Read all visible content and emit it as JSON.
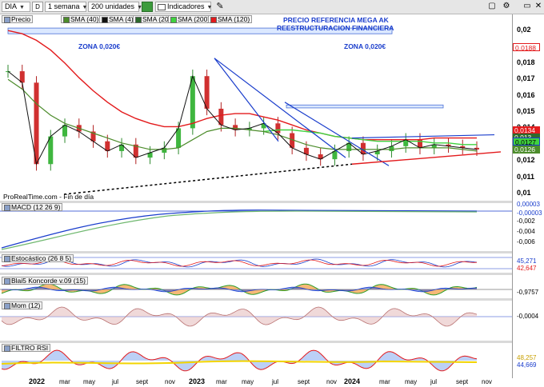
{
  "toolbar": {
    "symbol": "DIA",
    "period": "1 semana",
    "units": "200 unidades",
    "indicators": "Indicadores"
  },
  "legend": [
    {
      "label": "Precio",
      "color": "#8aa0c8"
    },
    {
      "label": "SMA (40)",
      "color": "#4c8c2b"
    },
    {
      "label": "SMA (4)",
      "color": "#111111"
    },
    {
      "label": "SMA (20)",
      "color": "#2d6a2d"
    },
    {
      "label": "SMA (200)",
      "color": "#3fd23f"
    },
    {
      "label": "SMA (120)",
      "color": "#e31a1c"
    }
  ],
  "annotations": {
    "headline_1": "PRECIO REFERENCIA MEGA AK",
    "headline_2": "REESTRUCTURACION FINANCIERA",
    "zone_left": "ZONA 0,020€",
    "zone_right": "ZONA 0,020€",
    "attribution": "ProRealTime.com - Fin de día"
  },
  "price_axis": [
    "0,02",
    "0,019",
    "0,018",
    "0,017",
    "0,016",
    "0,015",
    "0,014",
    "0,013",
    "0,012",
    "0,011",
    "0,01"
  ],
  "price_tags": {
    "sma120": "0,0188",
    "sma200": "0,0134",
    "sma20": "0,013",
    "price": "0,0127",
    "sma40": "0,0126"
  },
  "x_axis": [
    {
      "label": "2022",
      "year": true
    },
    {
      "label": "mar",
      "year": false
    },
    {
      "label": "may",
      "year": false
    },
    {
      "label": "jul",
      "year": false
    },
    {
      "label": "sept",
      "year": false
    },
    {
      "label": "nov",
      "year": false
    },
    {
      "label": "2023",
      "year": true
    },
    {
      "label": "mar",
      "year": false
    },
    {
      "label": "may",
      "year": false
    },
    {
      "label": "jul",
      "year": false
    },
    {
      "label": "sept",
      "year": false
    },
    {
      "label": "nov",
      "year": false
    },
    {
      "label": "2024",
      "year": true
    },
    {
      "label": "mar",
      "year": false
    },
    {
      "label": "may",
      "year": false
    },
    {
      "label": "jul",
      "year": false
    },
    {
      "label": "sept",
      "year": false
    },
    {
      "label": "nov",
      "year": false
    }
  ],
  "panels": {
    "macd": {
      "label": "MACD (12 26 9)",
      "axis": [
        "0,00003",
        "-0,002",
        "-0,004",
        "-0,006"
      ],
      "tags": [
        "0,00003",
        "-0,00003"
      ]
    },
    "stoch": {
      "label": "Estocástico (26 8 5)",
      "tags": [
        "45,271",
        "42,647"
      ]
    },
    "blai": {
      "label": "Blai5 Koncorde v.09 (15)",
      "tags": [
        "-0,9757"
      ]
    },
    "mom": {
      "label": "Mom (12)",
      "tags": [
        "-0,0004"
      ]
    },
    "rsi": {
      "label": "FILTRO RSI",
      "tags": [
        "48,257",
        "44,669"
      ]
    }
  },
  "chart_data": {
    "type": "candlestick",
    "title": "DIA",
    "x": [
      "2022-01",
      "2022-02",
      "2022-03",
      "2022-04",
      "2022-05",
      "2022-06",
      "2022-07",
      "2022-08",
      "2022-09",
      "2022-10",
      "2022-11",
      "2022-12",
      "2023-01",
      "2023-02",
      "2023-03",
      "2023-04",
      "2023-05",
      "2023-06",
      "2023-07",
      "2023-08",
      "2023-09",
      "2023-10",
      "2023-11",
      "2023-12",
      "2024-01",
      "2024-02",
      "2024-03",
      "2024-04",
      "2024-05",
      "2024-06",
      "2024-07",
      "2024-08",
      "2024-09",
      "2024-10"
    ],
    "close": [
      0.0175,
      0.0168,
      0.0118,
      0.0135,
      0.0142,
      0.0138,
      0.0132,
      0.0126,
      0.013,
      0.0122,
      0.0125,
      0.0128,
      0.014,
      0.0172,
      0.0152,
      0.0142,
      0.0139,
      0.014,
      0.0143,
      0.0137,
      0.0128,
      0.0124,
      0.0121,
      0.0126,
      0.0131,
      0.0124,
      0.0126,
      0.0129,
      0.0133,
      0.0128,
      0.013,
      0.0129,
      0.0128,
      0.0127
    ],
    "series": [
      {
        "name": "SMA (120)",
        "values": [
          0.02,
          0.0198,
          0.0194,
          0.0188,
          0.018,
          0.0171,
          0.0163,
          0.0156,
          0.015,
          0.0146,
          0.0143,
          0.0141,
          0.0141,
          0.0143,
          0.0146,
          0.0148,
          0.0149,
          0.0149,
          0.0147,
          0.0145,
          0.0142,
          0.0139,
          0.0137,
          0.0135,
          0.0134,
          0.0133,
          0.0133,
          0.0133,
          0.0133,
          0.0133,
          0.0134,
          0.0134,
          0.0134,
          0.0134
        ]
      },
      {
        "name": "SMA (200)",
        "values": [
          null,
          null,
          null,
          null,
          null,
          null,
          null,
          null,
          null,
          null,
          null,
          null,
          null,
          null,
          null,
          null,
          null,
          null,
          0.0138,
          0.0139,
          0.0139,
          0.0138,
          0.0137,
          0.0135,
          0.0134,
          0.0133,
          0.0132,
          0.0132,
          0.0132,
          0.0132,
          0.0131,
          0.0131,
          0.013,
          0.013
        ]
      },
      {
        "name": "SMA (40)",
        "values": [
          0.017,
          0.0164,
          0.0155,
          0.0148,
          0.0143,
          0.014,
          0.0137,
          0.0134,
          0.0131,
          0.0129,
          0.0127,
          0.0127,
          0.0128,
          0.0133,
          0.0138,
          0.014,
          0.014,
          0.0139,
          0.0138,
          0.0136,
          0.0133,
          0.013,
          0.0128,
          0.0127,
          0.0127,
          0.0127,
          0.0127,
          0.0127,
          0.0128,
          0.0128,
          0.0128,
          0.0128,
          0.0127,
          0.0126
        ]
      }
    ],
    "ylim": [
      0.0098,
      0.0204
    ],
    "price_axis_label": "Precio"
  }
}
